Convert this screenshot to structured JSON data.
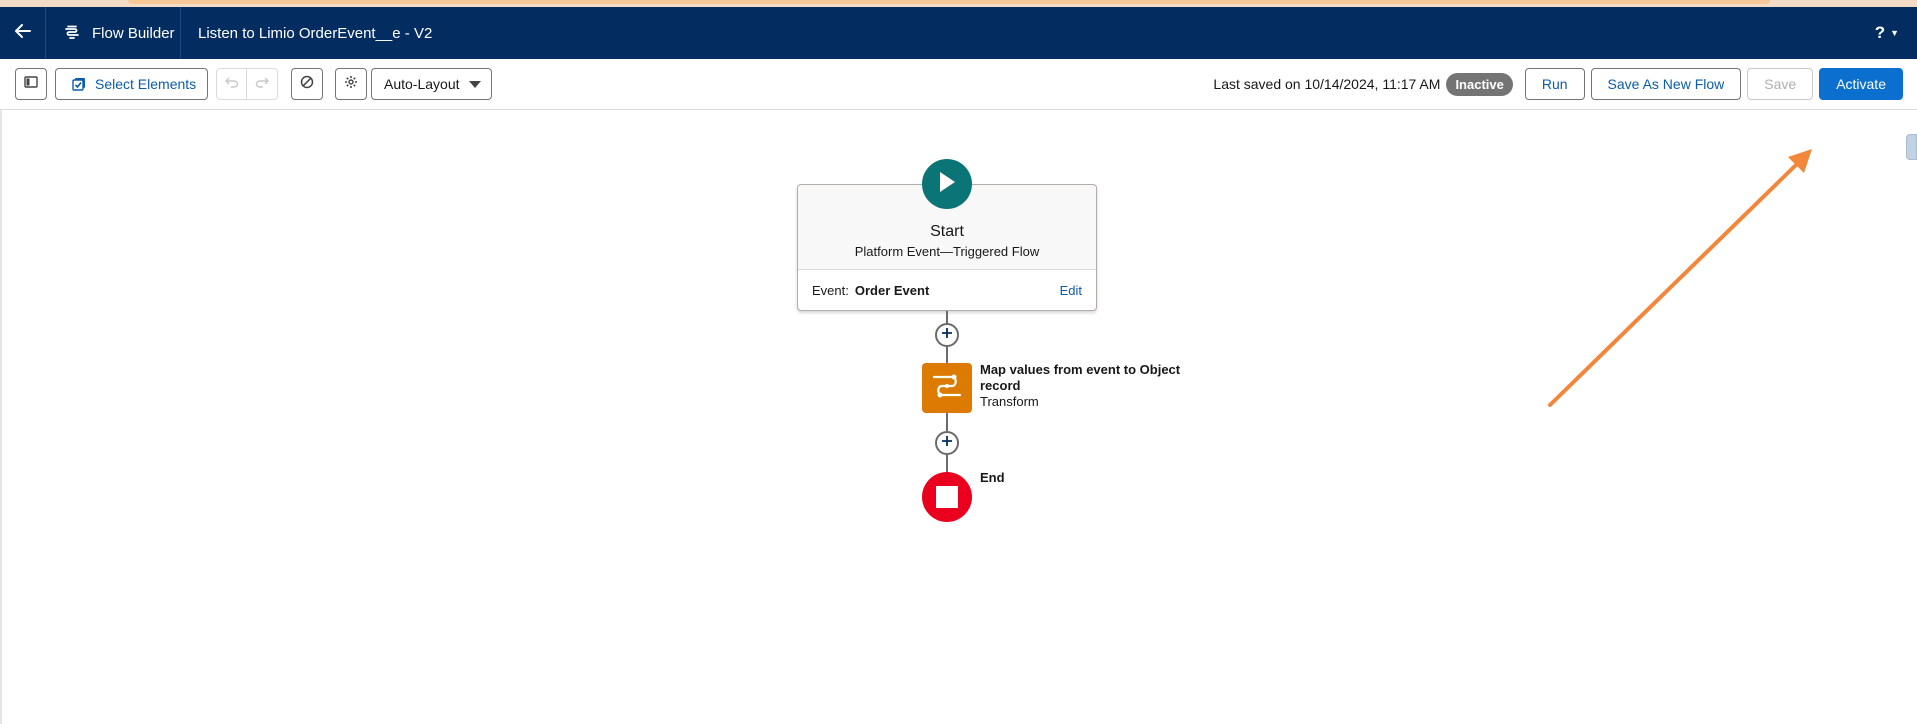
{
  "header": {
    "app_name": "Flow Builder",
    "flow_title": "Listen to Limio OrderEvent__e - V2",
    "help_label": "?",
    "icons": {
      "back": "back-arrow-icon",
      "app": "flow-builder-icon",
      "help_caret": "chevron-down-icon"
    }
  },
  "toolbar": {
    "select_elements_label": "Select Elements",
    "layout_value": "Auto-Layout",
    "last_saved": "Last saved on 10/14/2024, 11:17 AM",
    "status_badge": "Inactive",
    "run_label": "Run",
    "save_as_new_label": "Save As New Flow",
    "save_label": "Save",
    "activate_label": "Activate",
    "icons": [
      "toggle-panel-icon",
      "select-elements-icon",
      "undo-icon",
      "redo-icon",
      "error-block-icon",
      "gear-icon",
      "chevron-down-icon"
    ]
  },
  "canvas": {
    "start": {
      "title": "Start",
      "subtitle": "Platform Event—Triggered Flow",
      "event_label": "Event:",
      "event_value": "Order Event",
      "edit_label": "Edit"
    },
    "transform": {
      "name_line1": "Map values from event to Object",
      "name_line2": "record",
      "type": "Transform"
    },
    "end": {
      "label": "End"
    }
  },
  "colors": {
    "header_bg": "#032d60",
    "brand_blue": "#0b6fd0",
    "start_teal": "#0b7477",
    "transform_orange": "#dd7a01",
    "end_red": "#ea001e",
    "annotation_arrow": "#f2863b"
  }
}
